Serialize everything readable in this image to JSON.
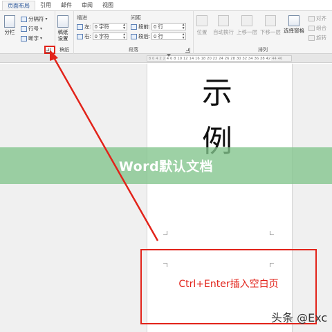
{
  "ribbon_tabs": [
    "页面布局",
    "引用",
    "邮件",
    "审阅",
    "视图"
  ],
  "ribbon": {
    "page_setup": {
      "columns_label": "分栏",
      "breaks_label": "分隔符",
      "line_numbers_label": "行号",
      "hyphenation_label": "断字"
    },
    "manuscript": {
      "button_label": "稿纸\n设置",
      "group_label": "稿纸"
    },
    "paragraph": {
      "group_label": "段落",
      "indent_header": "缩进",
      "spacing_header": "间距",
      "left_label": "左:",
      "left_value": "0 字符",
      "right_label": "右:",
      "right_value": "0 字符",
      "before_label": "段前:",
      "before_value": "0 行",
      "after_label": "段后:",
      "after_value": "0 行"
    },
    "arrange": {
      "group_label": "排列",
      "position_label": "位置",
      "wrap_label": "自动换行",
      "forward_label": "上移一层",
      "backward_label": "下移一层",
      "pane_label": "选择窗格",
      "align_label": "对齐",
      "group_btn_label": "组合",
      "rotate_label": "旋转"
    }
  },
  "ruler_text": "8 6 4 2    2  4  6  8  10  12  14  16  18  20  22  24  26  28  30  32  34  36  38    42 44 46",
  "document": {
    "char_1": "示",
    "char_2": "例"
  },
  "banner_title": "Word默认文档",
  "annotation": {
    "text": "Ctrl+Enter插入空白页",
    "color": "#e2231a"
  },
  "watermark": "头条 @Exc",
  "colors": {
    "accent": "#2b579a",
    "banner": "#82c48c",
    "annotation": "#e2231a"
  }
}
